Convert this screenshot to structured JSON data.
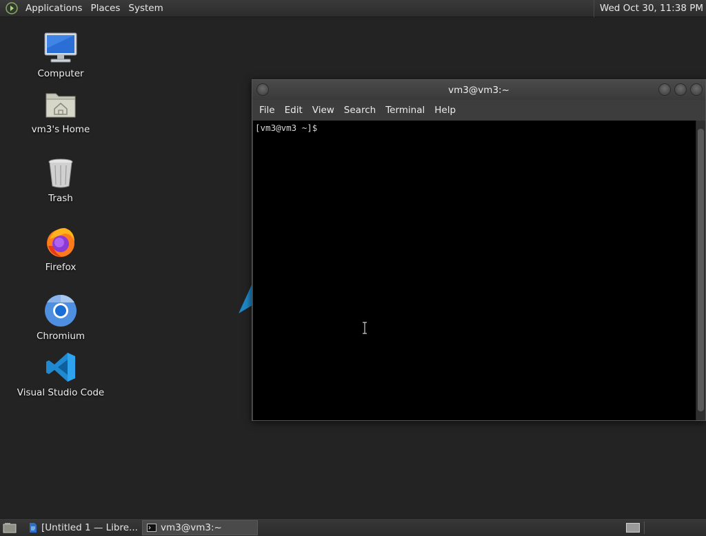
{
  "top_panel": {
    "menus": [
      "Applications",
      "Places",
      "System"
    ],
    "clock": "Wed Oct 30, 11:38 PM"
  },
  "desktop": {
    "icons": [
      {
        "label": "Computer",
        "icon": "computer-icon"
      },
      {
        "label": "vm3's Home",
        "icon": "home-folder-icon"
      },
      {
        "label": "Trash",
        "icon": "trash-icon"
      },
      {
        "label": "Firefox",
        "icon": "firefox-icon"
      },
      {
        "label": "Chromium",
        "icon": "chromium-icon"
      },
      {
        "label": "Visual Studio Code",
        "icon": "vscode-icon"
      }
    ]
  },
  "terminal": {
    "title": "vm3@vm3:~",
    "menu": [
      "File",
      "Edit",
      "View",
      "Search",
      "Terminal",
      "Help"
    ],
    "prompt": "[vm3@vm3 ~]$"
  },
  "taskbar": {
    "tasks": [
      {
        "label": "[Untitled 1 — Libre...",
        "icon": "libreoffice-writer-icon"
      },
      {
        "label": "vm3@vm3:~",
        "icon": "terminal-icon"
      }
    ]
  }
}
